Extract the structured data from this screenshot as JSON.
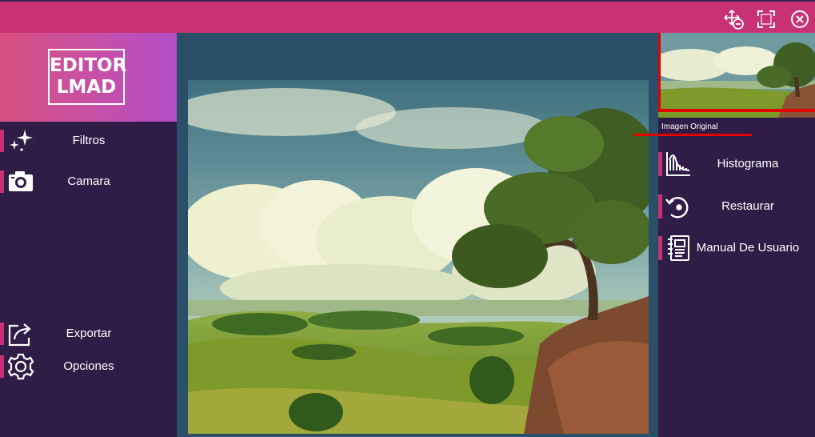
{
  "window": {
    "controls": [
      "move-icon",
      "fullscreen-icon",
      "close-icon"
    ]
  },
  "logo": {
    "line1": "EDITOR",
    "line2": "LMAD"
  },
  "sidebar": {
    "items": [
      {
        "label": "Filtros",
        "icon": "sparkles-icon"
      },
      {
        "label": "Camara",
        "icon": "camera-icon"
      },
      {
        "label": "Exportar",
        "icon": "share-icon"
      },
      {
        "label": "Opciones",
        "icon": "gear-icon"
      }
    ]
  },
  "preview": {
    "caption": "Imagen Original"
  },
  "tools": {
    "items": [
      {
        "label": "Histograma",
        "icon": "histogram-icon"
      },
      {
        "label": "Restaurar",
        "icon": "restore-icon"
      },
      {
        "label": "Manual De Usuario",
        "icon": "manual-icon"
      }
    ]
  },
  "colors": {
    "titlebar": "#c83274",
    "sidebar": "#2f1d47",
    "canvas": "#2c4f69",
    "accent": "#c83274",
    "highlight": "#e00000"
  }
}
